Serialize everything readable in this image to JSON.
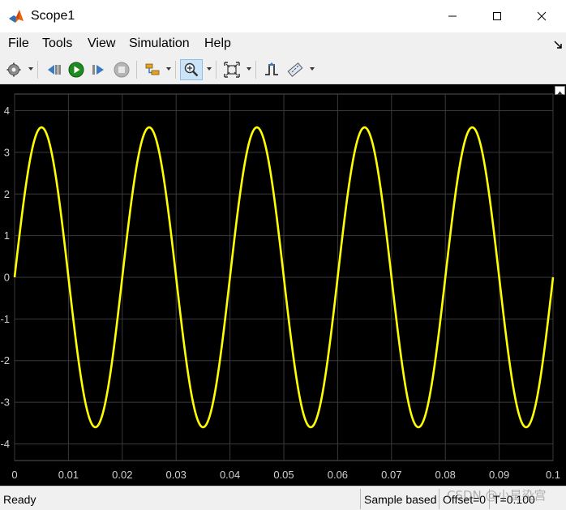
{
  "window": {
    "title": "Scope1",
    "icon": "matlab-icon"
  },
  "menu": {
    "items": [
      "File",
      "Tools",
      "View",
      "Simulation",
      "Help"
    ]
  },
  "toolbar": {
    "icons": [
      "settings-icon",
      "step-back-icon",
      "run-icon",
      "step-forward-icon",
      "stop-icon",
      "signal-selector-icon",
      "zoom-in-icon",
      "fit-to-view-icon",
      "triggers-icon",
      "cursor-measurements-icon"
    ]
  },
  "colors": {
    "plot_background": "#000000",
    "grid": "#3a3a3a",
    "signal": "#ffff00",
    "axis_text": "#d0d0d0"
  },
  "chart_data": {
    "type": "line",
    "title": "",
    "xlabel": "",
    "ylabel": "",
    "xlim": [
      0,
      0.1
    ],
    "ylim": [
      -4.4,
      4.4
    ],
    "xticks": [
      "0",
      "0.01",
      "0.02",
      "0.03",
      "0.04",
      "0.05",
      "0.06",
      "0.07",
      "0.08",
      "0.09",
      "0.1"
    ],
    "yticks": [
      "4",
      "3",
      "2",
      "1",
      "0",
      "-1",
      "-2",
      "-3",
      "-4"
    ],
    "grid": true,
    "series": [
      {
        "amplitude": 3.6,
        "frequency_hz": 50,
        "phase_deg": 0,
        "color": "#ffff00"
      }
    ]
  },
  "status": {
    "ready": "Ready",
    "sample_mode": "Sample based",
    "offset": "Offset=0",
    "time": "T=0.100"
  },
  "watermark": "CSDN @小星染宫"
}
